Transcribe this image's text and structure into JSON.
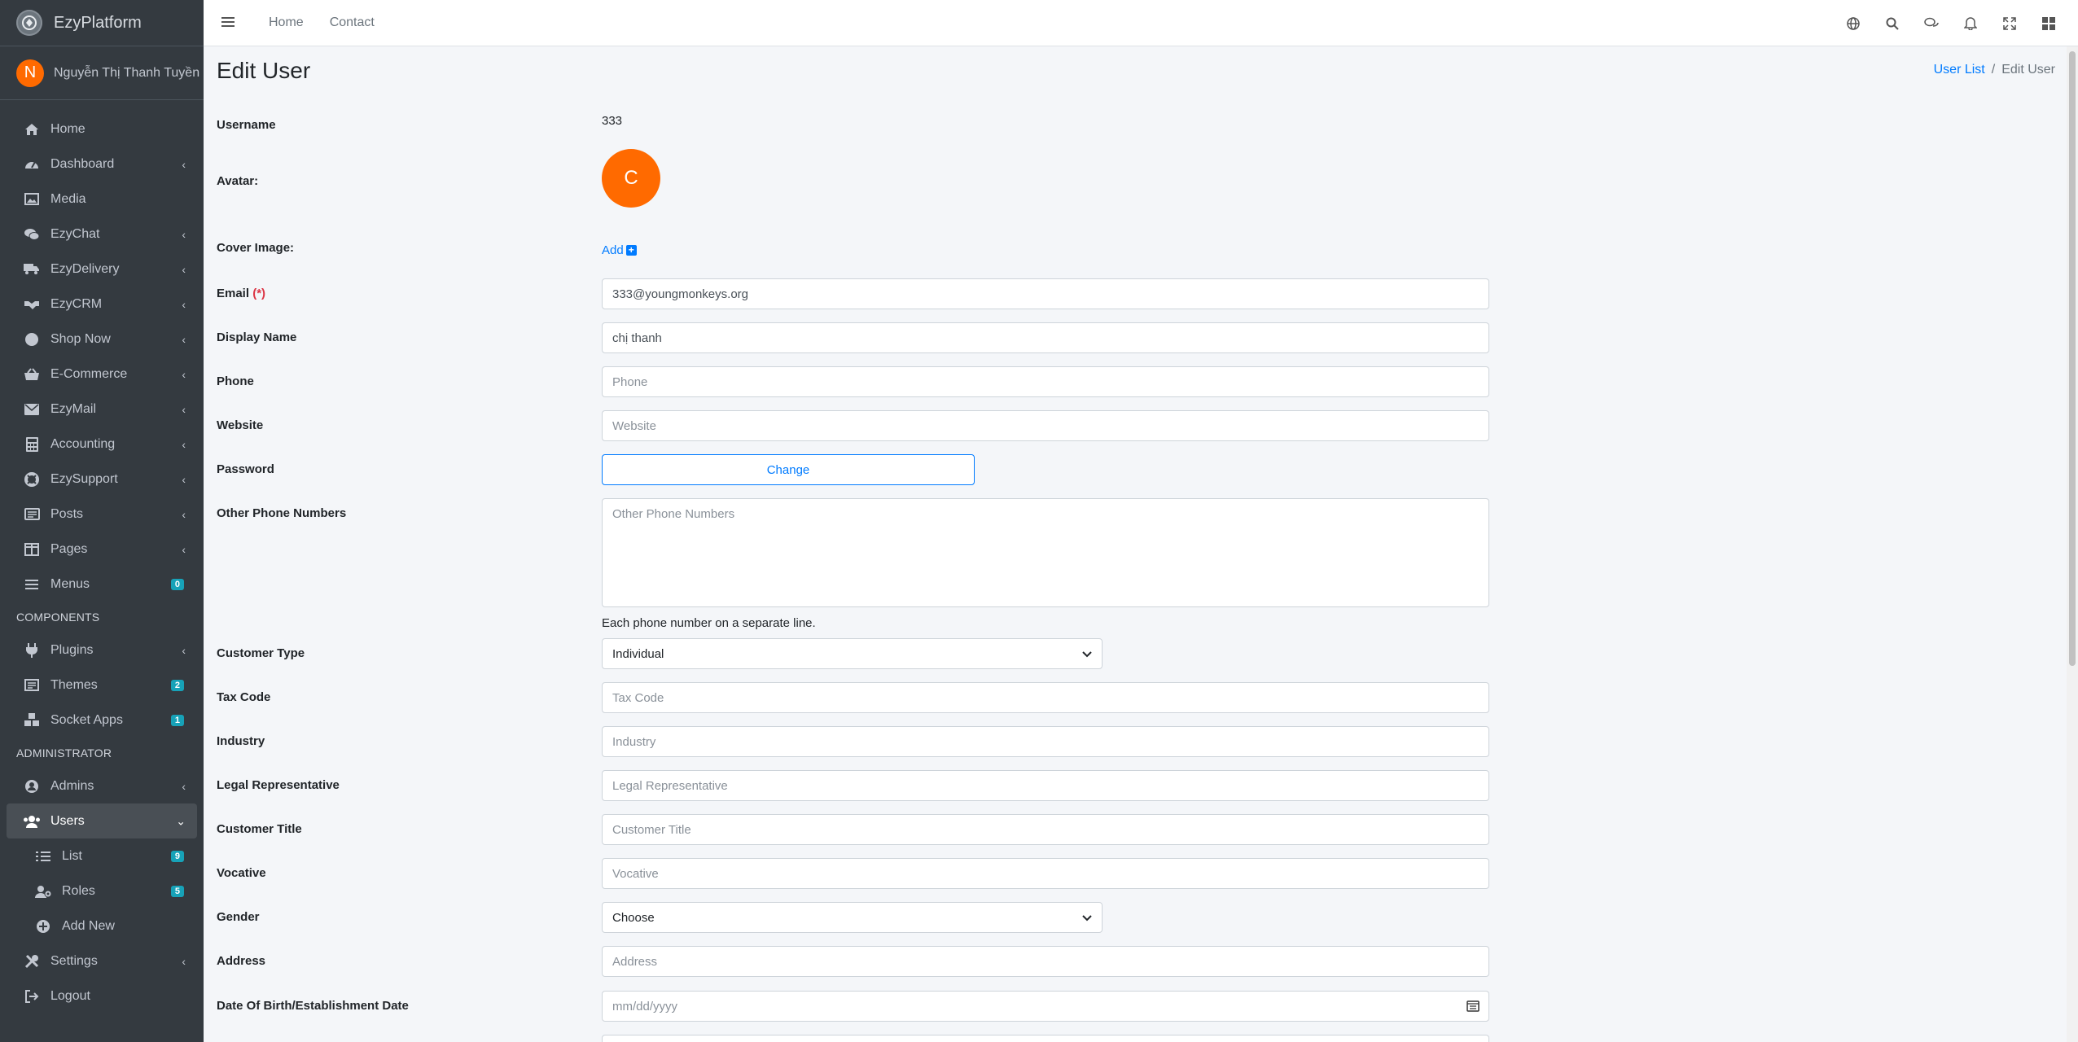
{
  "brand": {
    "name": "EzyPlatform"
  },
  "user_panel": {
    "initial": "N",
    "name": "Nguyễn Thị Thanh Tuyền"
  },
  "sidebar": {
    "items": [
      {
        "label": "Home",
        "icon": "home-icon",
        "caret": false
      },
      {
        "label": "Dashboard",
        "icon": "dashboard-icon",
        "caret": true
      },
      {
        "label": "Media",
        "icon": "image-icon",
        "caret": false
      },
      {
        "label": "EzyChat",
        "icon": "chat-icon",
        "caret": true
      },
      {
        "label": "EzyDelivery",
        "icon": "truck-icon",
        "caret": true
      },
      {
        "label": "EzyCRM",
        "icon": "handshake-icon",
        "caret": true
      },
      {
        "label": "Shop Now",
        "icon": "circle-icon",
        "caret": true
      },
      {
        "label": "E-Commerce",
        "icon": "basket-icon",
        "caret": true
      },
      {
        "label": "EzyMail",
        "icon": "envelope-icon",
        "caret": true
      },
      {
        "label": "Accounting",
        "icon": "calculator-icon",
        "caret": true
      },
      {
        "label": "EzySupport",
        "icon": "lifebuoy-icon",
        "caret": true
      },
      {
        "label": "Posts",
        "icon": "newspaper-icon",
        "caret": true
      },
      {
        "label": "Pages",
        "icon": "columns-icon",
        "caret": true
      },
      {
        "label": "Menus",
        "icon": "bars-icon",
        "badge": "0"
      }
    ],
    "components_header": "COMPONENTS",
    "components": [
      {
        "label": "Plugins",
        "icon": "plug-icon",
        "caret": true
      },
      {
        "label": "Themes",
        "icon": "theme-icon",
        "badge": "2"
      },
      {
        "label": "Socket Apps",
        "icon": "cubes-icon",
        "badge": "1"
      }
    ],
    "admin_header": "ADMINISTRATOR",
    "admin": [
      {
        "label": "Admins",
        "icon": "user-circle-icon",
        "caret": true
      },
      {
        "label": "Users",
        "icon": "users-icon",
        "active": true
      },
      {
        "label": "List",
        "icon": "list-icon",
        "badge": "9",
        "sub": true
      },
      {
        "label": "Roles",
        "icon": "user-cog-icon",
        "badge": "5",
        "sub": true
      },
      {
        "label": "Add New",
        "icon": "plus-circle-icon",
        "sub": true
      },
      {
        "label": "Settings",
        "icon": "tools-icon",
        "caret": true
      },
      {
        "label": "Logout",
        "icon": "logout-icon"
      }
    ]
  },
  "topbar": {
    "links": [
      "Home",
      "Contact"
    ],
    "icons": [
      "globe-icon",
      "search-icon",
      "comments-icon",
      "bell-icon",
      "expand-icon",
      "grid-icon"
    ]
  },
  "page": {
    "title": "Edit User",
    "breadcrumb": {
      "link": "User List",
      "separator": "/",
      "current": "Edit User"
    }
  },
  "form": {
    "username": {
      "label": "Username",
      "value": "333"
    },
    "avatar": {
      "label": "Avatar:",
      "initial": "C"
    },
    "cover_image": {
      "label": "Cover Image:",
      "action": "Add",
      "plus": "+"
    },
    "email": {
      "label": "Email",
      "required_mark": "(*)",
      "value": "333@youngmonkeys.org"
    },
    "display_name": {
      "label": "Display Name",
      "value": "chị thanh"
    },
    "phone": {
      "label": "Phone",
      "placeholder": "Phone"
    },
    "website": {
      "label": "Website",
      "placeholder": "Website"
    },
    "password": {
      "label": "Password",
      "button": "Change"
    },
    "other_phones": {
      "label": "Other Phone Numbers",
      "placeholder": "Other Phone Numbers",
      "help": "Each phone number on a separate line."
    },
    "customer_type": {
      "label": "Customer Type",
      "value": "Individual"
    },
    "tax_code": {
      "label": "Tax Code",
      "placeholder": "Tax Code"
    },
    "industry": {
      "label": "Industry",
      "placeholder": "Industry"
    },
    "legal_representative": {
      "label": "Legal Representative",
      "placeholder": "Legal Representative"
    },
    "customer_title": {
      "label": "Customer Title",
      "placeholder": "Customer Title"
    },
    "vocative": {
      "label": "Vocative",
      "placeholder": "Vocative"
    },
    "gender": {
      "label": "Gender",
      "value": "Choose"
    },
    "address": {
      "label": "Address",
      "placeholder": "Address"
    },
    "dob": {
      "label": "Date Of Birth/Establishment Date",
      "placeholder": "mm/dd/yyyy"
    }
  },
  "colors": {
    "sidebar": "#343a40",
    "accent": "#007bff",
    "avatar": "#ff6a00",
    "badge": "#17a2b8"
  }
}
